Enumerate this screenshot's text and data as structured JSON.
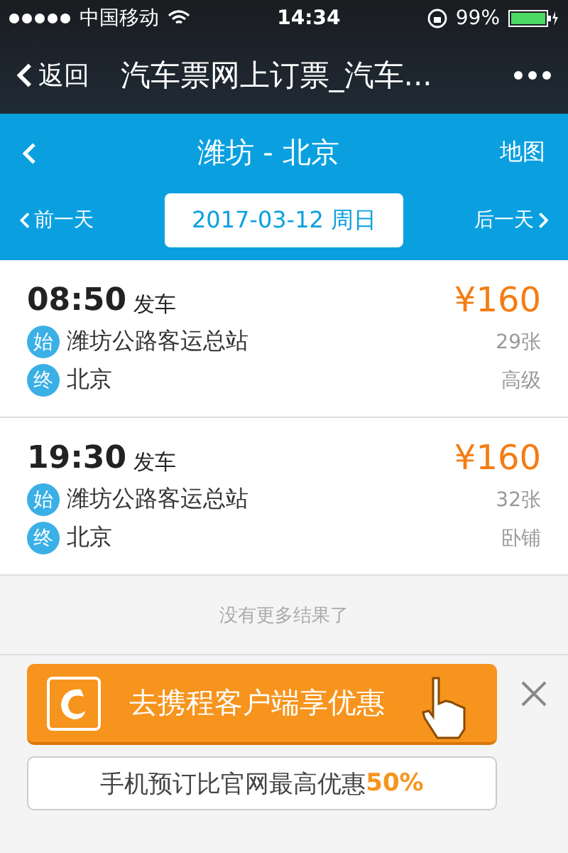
{
  "status_bar": {
    "carrier": "中国移动",
    "time": "14:34",
    "battery": "99%"
  },
  "nav_bar": {
    "back": "返回",
    "title": "汽车票网上订票_汽车..."
  },
  "header": {
    "title": "潍坊 - 北京",
    "map": "地图"
  },
  "date_bar": {
    "prev": "前一天",
    "date": "2017-03-12 周日",
    "next": "后一天"
  },
  "tickets": [
    {
      "time": "08:50",
      "suffix": "发车",
      "price": "¥160",
      "from_badge": "始",
      "from": "潍坊公路客运总站",
      "seats": "29张",
      "to_badge": "终",
      "to": "北京",
      "class": "高级"
    },
    {
      "time": "19:30",
      "suffix": "发车",
      "price": "¥160",
      "from_badge": "始",
      "from": "潍坊公路客运总站",
      "seats": "32张",
      "to_badge": "终",
      "to": "北京",
      "class": "卧铺"
    }
  ],
  "end_note": "没有更多结果了",
  "promo": {
    "button": "去携程客户端享优惠",
    "subtitle": "手机预订比官网最高优惠**50%**"
  }
}
